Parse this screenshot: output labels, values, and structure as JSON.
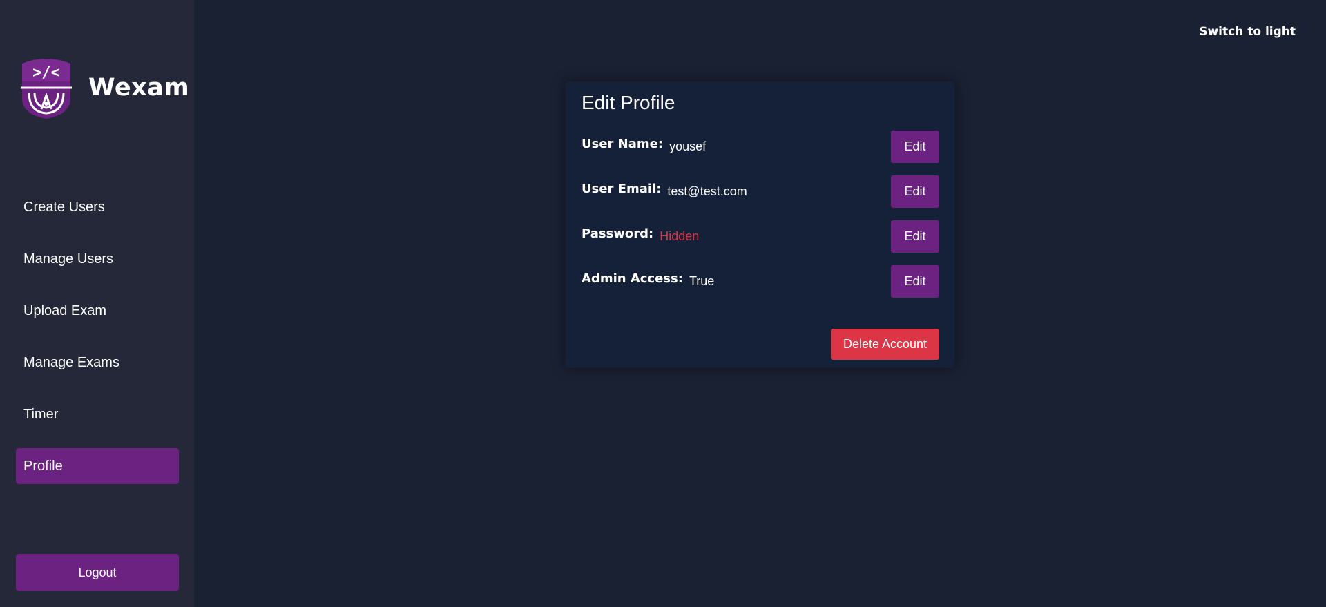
{
  "app": {
    "name": "Wexam",
    "logo_icon": "wexam-shield-code-logo",
    "colors": {
      "background": "#1a2133",
      "sidebar": "#252838",
      "card": "#152039",
      "accent": "#6b2280",
      "danger": "#dc3545"
    }
  },
  "header": {
    "theme_toggle_label": "Switch to light"
  },
  "sidebar": {
    "items": [
      {
        "label": "Create Users",
        "active": false
      },
      {
        "label": "Manage Users",
        "active": false
      },
      {
        "label": "Upload Exam",
        "active": false
      },
      {
        "label": "Manage Exams",
        "active": false
      },
      {
        "label": "Timer",
        "active": false
      },
      {
        "label": "Profile",
        "active": true
      }
    ],
    "logout_label": "Logout"
  },
  "profile": {
    "title": "Edit Profile",
    "fields": [
      {
        "label": "User Name:",
        "value": "yousef",
        "edit_label": "Edit"
      },
      {
        "label": "User Email:",
        "value": "test@test.com",
        "edit_label": "Edit"
      },
      {
        "label": "Password:",
        "value": "Hidden",
        "edit_label": "Edit"
      },
      {
        "label": "Admin Access:",
        "value": "True",
        "edit_label": "Edit"
      }
    ],
    "delete_label": "Delete Account"
  }
}
